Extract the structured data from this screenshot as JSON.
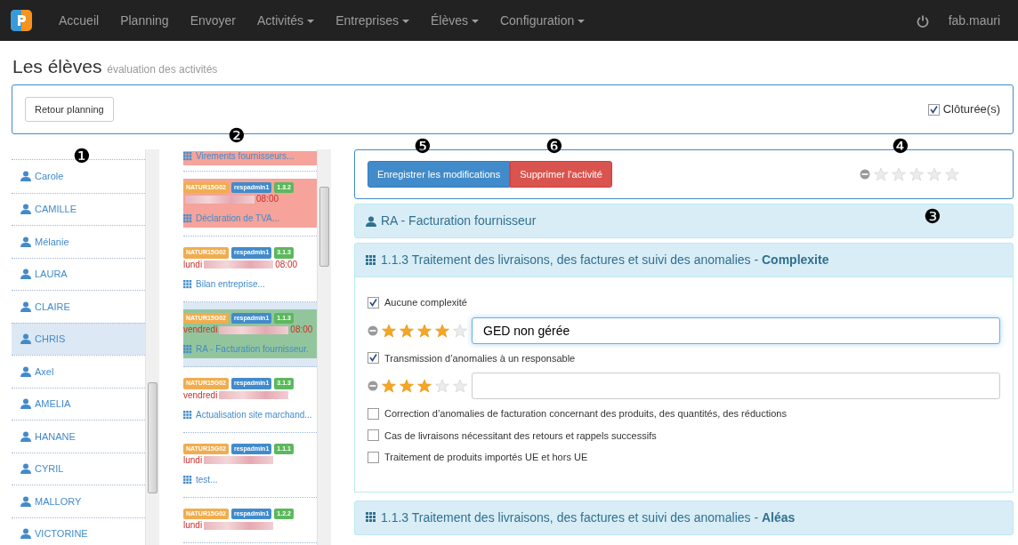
{
  "navbar": {
    "items": [
      {
        "label": "Accueil",
        "dropdown": false
      },
      {
        "label": "Planning",
        "dropdown": false
      },
      {
        "label": "Envoyer",
        "dropdown": false
      },
      {
        "label": "Activités",
        "dropdown": true
      },
      {
        "label": "Entreprises",
        "dropdown": true
      },
      {
        "label": "Élèves",
        "dropdown": true
      },
      {
        "label": "Configuration",
        "dropdown": true
      }
    ],
    "user": "fab.mauri"
  },
  "header": {
    "title": "Les élèves",
    "subtitle": "évaluation des activités"
  },
  "toolbar": {
    "back_button": "Retour planning",
    "closed_filter": {
      "label": "Clôturée(s)",
      "checked": true
    }
  },
  "callouts": [
    "❷",
    "❺",
    "❻",
    "❹",
    "❶",
    "❸"
  ],
  "students": [
    {
      "name": "Carole",
      "selected": false
    },
    {
      "name": "CAMILLE",
      "selected": false
    },
    {
      "name": "Mélanie",
      "selected": false
    },
    {
      "name": "LAURA",
      "selected": false
    },
    {
      "name": "CLAIRE",
      "selected": false
    },
    {
      "name": "CHRIS",
      "selected": true
    },
    {
      "name": "Axel",
      "selected": false
    },
    {
      "name": "AMELIA",
      "selected": false
    },
    {
      "name": "HANANE",
      "selected": false
    },
    {
      "name": "CYRIL",
      "selected": false
    },
    {
      "name": "MALLORY",
      "selected": false
    },
    {
      "name": "VICTORINE",
      "selected": false
    }
  ],
  "activities": [
    {
      "partial": true,
      "title": "Virements fournisseurs...",
      "color": "#f5a39b",
      "selected": false
    },
    {
      "tags": [
        "NATUR15G02",
        "respadmin1",
        "1.3.2"
      ],
      "time": "08:00",
      "title": "Déclaration de TVA...",
      "color": "#f5a39b",
      "selected": false
    },
    {
      "tags": [
        "NATUR15G02",
        "respadmin1",
        "3.1.3"
      ],
      "day": "lundi",
      "time": "08:00",
      "title": "Bilan entreprise...",
      "color": "#ffffff",
      "selected": false
    },
    {
      "tags": [
        "NATUR15G02",
        "respadmin1",
        "1.1.3"
      ],
      "day": "vendredi",
      "time": "08:00",
      "title": "RA - Facturation fournisseur.",
      "color": "#93c59d",
      "selected": true
    },
    {
      "tags": [
        "NATUR15G02",
        "respadmin1",
        "3.1.3"
      ],
      "day": "vendredi",
      "title": "Actualisation site marchand...",
      "color": "#ffffff",
      "selected": false
    },
    {
      "tags": [
        "NATUR15G02",
        "respadmin1",
        "1.1.1"
      ],
      "day": "lundi",
      "title": "test...",
      "color": "#ffffff",
      "selected": false
    },
    {
      "tags": [
        "NATUR15G02",
        "respadmin1",
        "1.2.2"
      ],
      "day": "lundi",
      "color": "#ffffff",
      "selected": false
    }
  ],
  "actions": {
    "save": "Enregistrer les modifications",
    "delete": "Supprimer l'activité",
    "stars": 0
  },
  "activity_title": "RA - Facturation fournisseur",
  "sections": [
    {
      "title": "1.1.3 Traitement des livraisons, des factures et suivi des anomalies - **Complexite**",
      "criteria": [
        {
          "kind": "check",
          "label": "Aucune complexité",
          "checked": true
        },
        {
          "kind": "rating",
          "stars": 4,
          "value": "GED non gérée",
          "focused": true
        },
        {
          "kind": "check",
          "label": "Transmission d’anomalies à un responsable",
          "checked": true
        },
        {
          "kind": "rating",
          "stars": 3,
          "focused": false
        },
        {
          "kind": "check",
          "label": "Correction d’anomalies de facturation concernant des produits, des quantités, des réductions",
          "checked": false
        },
        {
          "kind": "check",
          "label": "Cas de livraisons nécessitant des retours et rappels successifs",
          "checked": false
        },
        {
          "kind": "check",
          "label": "Traitement de produits importés UE et hors UE",
          "checked": false
        }
      ]
    },
    {
      "title": "1.1.3 Traitement des livraisons, des factures et suivi des anomalies - **Aléas**"
    }
  ]
}
